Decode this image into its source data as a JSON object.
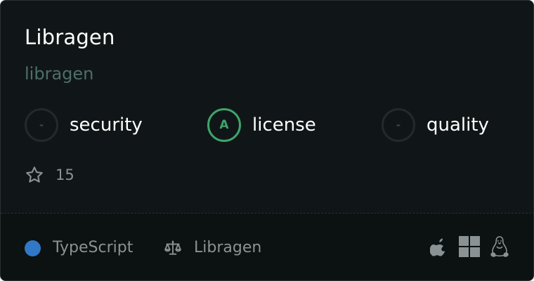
{
  "package": {
    "name": "Libragen",
    "slug": "libragen"
  },
  "scores": [
    {
      "grade": "-",
      "label": "security"
    },
    {
      "grade": "A",
      "label": "license"
    },
    {
      "grade": "-",
      "label": "quality"
    }
  ],
  "stars": {
    "icon": "star-icon",
    "count": "15"
  },
  "footer": {
    "language": {
      "label": "TypeScript",
      "color": "#3178c6"
    },
    "license": {
      "icon": "scale-icon",
      "label": "Libragen"
    },
    "platforms": [
      "apple-icon",
      "windows-icon",
      "linux-icon"
    ]
  },
  "colors": {
    "background": "#101617",
    "footer_background": "#0c1112",
    "grade_a": "#3fa46a",
    "slug": "#4f6e69"
  }
}
